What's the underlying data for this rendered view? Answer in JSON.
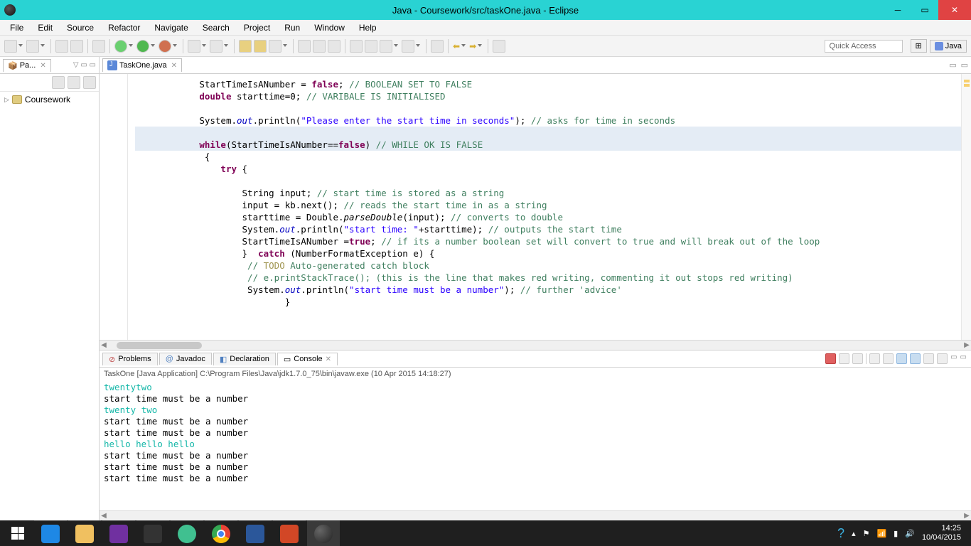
{
  "window": {
    "title": "Java - Coursework/src/taskOne.java - Eclipse"
  },
  "menu": [
    "File",
    "Edit",
    "Source",
    "Refactor",
    "Navigate",
    "Search",
    "Project",
    "Run",
    "Window",
    "Help"
  ],
  "quick_access": "Quick Access",
  "perspective_label": "Java",
  "package_explorer": {
    "tab": "Pa...",
    "project": "Coursework"
  },
  "editor": {
    "tab": "TaskOne.java",
    "lines": [
      {
        "indent": 3,
        "parts": [
          {
            "t": "StartTimeIsANumber = "
          },
          {
            "t": "false",
            "c": "kw"
          },
          {
            "t": "; "
          },
          {
            "t": "// BOOLEAN SET TO FALSE",
            "c": "cmt"
          }
        ]
      },
      {
        "indent": 3,
        "parts": [
          {
            "t": "double",
            "c": "kw"
          },
          {
            "t": " starttime=0; "
          },
          {
            "t": "// VARIBALE IS INITIALISED",
            "c": "cmt"
          }
        ]
      },
      {
        "indent": 3,
        "parts": []
      },
      {
        "indent": 3,
        "parts": [
          {
            "t": "System."
          },
          {
            "t": "out",
            "c": "fld stg"
          },
          {
            "t": ".println("
          },
          {
            "t": "\"Please enter the start time in seconds\"",
            "c": "str"
          },
          {
            "t": "); "
          },
          {
            "t": "// asks for time in seconds",
            "c": "cmt"
          }
        ]
      },
      {
        "indent": 3,
        "parts": [],
        "hl": true,
        "empty": true
      },
      {
        "indent": 3,
        "parts": [
          {
            "t": "while",
            "c": "kw"
          },
          {
            "t": "(StartTimeIsANumber=="
          },
          {
            "t": "false",
            "c": "kw"
          },
          {
            "t": ") "
          },
          {
            "t": "// WHILE OK IS FALSE",
            "c": "cmt"
          }
        ],
        "hl": true
      },
      {
        "indent": 3,
        "parts": [
          {
            "t": " {"
          }
        ]
      },
      {
        "indent": 4,
        "parts": [
          {
            "t": "try",
            "c": "kw"
          },
          {
            "t": " {"
          }
        ]
      },
      {
        "indent": 4,
        "parts": []
      },
      {
        "indent": 5,
        "parts": [
          {
            "t": "String input; "
          },
          {
            "t": "// start time is stored as a string",
            "c": "cmt"
          }
        ]
      },
      {
        "indent": 5,
        "parts": [
          {
            "t": "input = kb.next(); "
          },
          {
            "t": "// reads the start time in as a string",
            "c": "cmt"
          }
        ]
      },
      {
        "indent": 5,
        "parts": [
          {
            "t": "starttime = Double."
          },
          {
            "t": "parseDouble",
            "c": "stg"
          },
          {
            "t": "(input); "
          },
          {
            "t": "// converts to double",
            "c": "cmt"
          }
        ]
      },
      {
        "indent": 5,
        "parts": [
          {
            "t": "System."
          },
          {
            "t": "out",
            "c": "fld stg"
          },
          {
            "t": ".println("
          },
          {
            "t": "\"start time: \"",
            "c": "str"
          },
          {
            "t": "+starttime); "
          },
          {
            "t": "// outputs the start time",
            "c": "cmt"
          }
        ]
      },
      {
        "indent": 5,
        "parts": [
          {
            "t": "StartTimeIsANumber ="
          },
          {
            "t": "true",
            "c": "kw"
          },
          {
            "t": "; "
          },
          {
            "t": "// if its a number boolean set will convert to true and will break out of the loop",
            "c": "cmt"
          }
        ]
      },
      {
        "indent": 5,
        "parts": [
          {
            "t": "}  "
          },
          {
            "t": "catch",
            "c": "kw"
          },
          {
            "t": " (NumberFormatException e) {"
          }
        ]
      },
      {
        "indent": 5,
        "parts": [
          {
            "t": " "
          },
          {
            "t": "// ",
            "c": "cmt"
          },
          {
            "t": "TODO",
            "c": "tcmt"
          },
          {
            "t": " Auto-generated catch block",
            "c": "cmt"
          }
        ]
      },
      {
        "indent": 5,
        "parts": [
          {
            "t": " "
          },
          {
            "t": "// e.printStackTrace(); (this is the line that makes red writing, commenting it out stops red writing)",
            "c": "cmt"
          }
        ]
      },
      {
        "indent": 5,
        "parts": [
          {
            "t": " System."
          },
          {
            "t": "out",
            "c": "fld stg"
          },
          {
            "t": ".println("
          },
          {
            "t": "\"start time must be a number\"",
            "c": "str"
          },
          {
            "t": "); "
          },
          {
            "t": "// further 'advice'",
            "c": "cmt"
          }
        ]
      },
      {
        "indent": 7,
        "parts": [
          {
            "t": "}"
          }
        ]
      }
    ]
  },
  "bottom_tabs": {
    "problems": "Problems",
    "javadoc": "Javadoc",
    "declaration": "Declaration",
    "console": "Console"
  },
  "console": {
    "launch": "TaskOne [Java Application] C:\\Program Files\\Java\\jdk1.7.0_75\\bin\\javaw.exe (10 Apr 2015 14:18:27)",
    "lines": [
      {
        "text": "twentytwo",
        "in": true
      },
      {
        "text": "start time must be a number"
      },
      {
        "text": "twenty two",
        "in": true
      },
      {
        "text": "start time must be a number"
      },
      {
        "text": "start time must be a number"
      },
      {
        "text": "hello hello hello",
        "in": true
      },
      {
        "text": "start time must be a number"
      },
      {
        "text": "start time must be a number"
      },
      {
        "text": "start time must be a number"
      }
    ]
  },
  "taskbar": {
    "time": "14:25",
    "date": "10/04/2015"
  }
}
